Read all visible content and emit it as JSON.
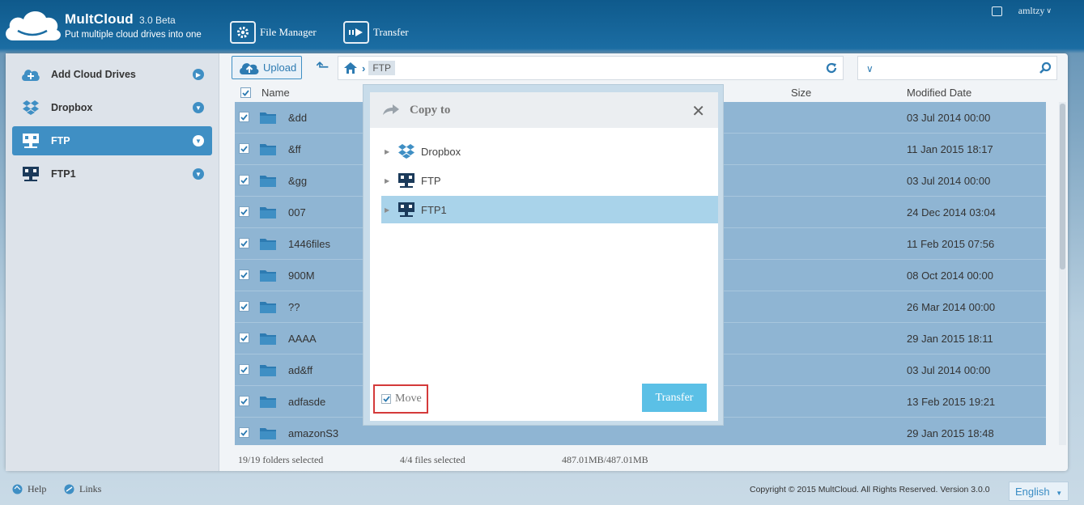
{
  "header": {
    "brand": "MultCloud",
    "version": "3.0 Beta",
    "tagline": "Put multiple cloud drives into one",
    "nav": [
      {
        "label": "File Manager",
        "icon": "gear-icon"
      },
      {
        "label": "Transfer",
        "icon": "arrow-right-icon"
      }
    ],
    "user": "amltzy"
  },
  "sidebar": {
    "items": [
      {
        "label": "Add Cloud Drives",
        "icon": "add-cloud-icon"
      },
      {
        "label": "Dropbox",
        "icon": "dropbox-icon"
      },
      {
        "label": "FTP",
        "icon": "ftp-icon",
        "active": true
      },
      {
        "label": "FTP1",
        "icon": "ftp-icon"
      }
    ]
  },
  "toolbar": {
    "upload_label": "Upload",
    "path": [
      "FTP"
    ]
  },
  "table": {
    "columns": {
      "name": "Name",
      "size": "Size",
      "modified": "Modified Date"
    },
    "rows": [
      {
        "name": "&dd",
        "date": "03 Jul 2014 00:00"
      },
      {
        "name": "&ff",
        "date": "11 Jan 2015 18:17"
      },
      {
        "name": "&gg",
        "date": "03 Jul 2014 00:00"
      },
      {
        "name": "007",
        "date": "24 Dec 2014 03:04"
      },
      {
        "name": "1446files",
        "date": "11 Feb 2015 07:56"
      },
      {
        "name": "900M",
        "date": "08 Oct 2014 00:00"
      },
      {
        "name": "??",
        "date": "26 Mar 2014 00:00"
      },
      {
        "name": "AAAA",
        "date": "29 Jan 2015 18:11"
      },
      {
        "name": "ad&ff",
        "date": "03 Jul 2014 00:00"
      },
      {
        "name": "adfasde",
        "date": "13 Feb 2015 19:21"
      },
      {
        "name": "amazonS3",
        "date": "29 Jan 2015 18:48"
      }
    ]
  },
  "status": {
    "folders": "19/19 folders selected",
    "files": "4/4 files selected",
    "size": "487.01MB/487.01MB"
  },
  "dialog": {
    "title": "Copy to",
    "tree": [
      {
        "label": "Dropbox",
        "icon": "dropbox-icon"
      },
      {
        "label": "FTP",
        "icon": "ftp-icon"
      },
      {
        "label": "FTP1",
        "icon": "ftp-icon",
        "selected": true
      }
    ],
    "move_label": "Move",
    "move_checked": true,
    "transfer_label": "Transfer"
  },
  "footer": {
    "help": "Help",
    "links": "Links",
    "copyright": "Copyright © 2015 MultCloud. All Rights Reserved. Version 3.0.0",
    "language": "English"
  },
  "colors": {
    "accent": "#3f8fc4",
    "selected_row": "#8fb5d3",
    "transfer_button": "#5bc0e6",
    "highlight_border": "#d43a3a"
  }
}
